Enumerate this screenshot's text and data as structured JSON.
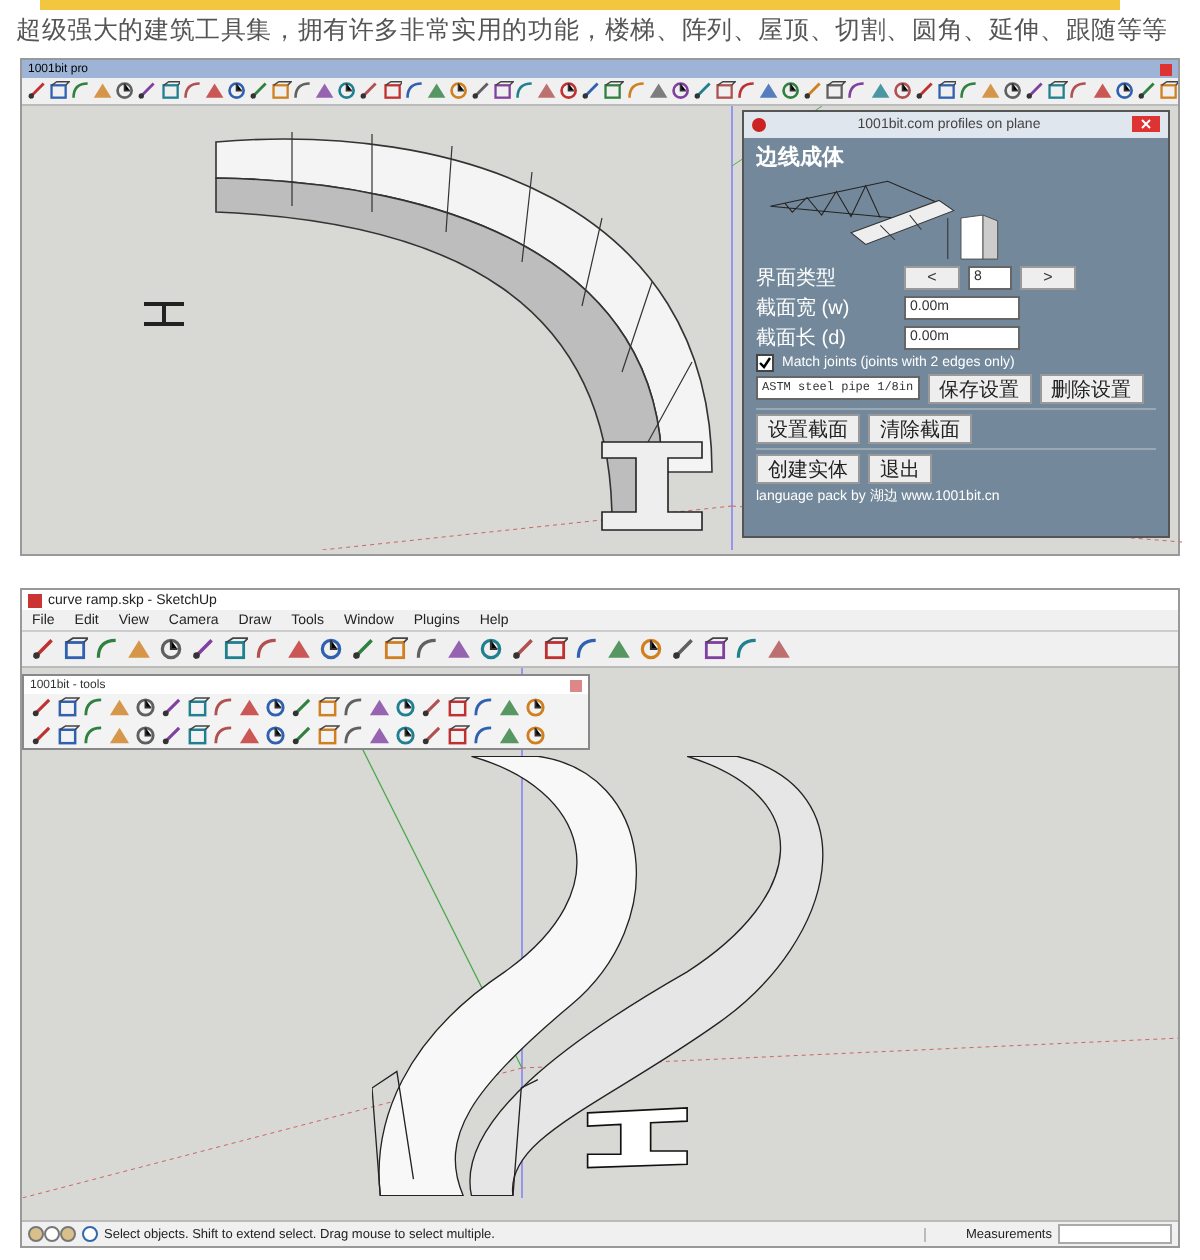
{
  "caption": "超级强大的建筑工具集，拥有许多非常实用的功能，楼梯、阵列、屋顶、切割、圆角、延伸、跟随等等",
  "screenshots": [
    {
      "kind": "plugin-dialog",
      "window_title": "1001bit pro",
      "dialog": {
        "title": "1001bit.com profiles on plane",
        "heading": "边线成体",
        "profile_type_label": "界面类型",
        "prev_button": "<",
        "type_value": "8",
        "next_button": ">",
        "width_label": "截面宽 (w)",
        "width_value": "0.00m",
        "length_label": "截面长 (d)",
        "length_value": "0.00m",
        "match_joints": {
          "label": "Match joints (joints with 2 edges only)",
          "checked": true
        },
        "preset": "ASTM steel pipe 1/8in",
        "button_rows": [
          [
            "保存设置",
            "删除设置"
          ],
          [
            "设置截面",
            "清除截面"
          ],
          [
            "创建实体",
            "退出"
          ]
        ],
        "footer": "language pack by 湖边 www.1001bit.cn"
      }
    },
    {
      "kind": "sketchup",
      "window_title": "curve ramp.skp - SketchUp",
      "menu": [
        "File",
        "Edit",
        "View",
        "Camera",
        "Draw",
        "Tools",
        "Window",
        "Plugins",
        "Help"
      ],
      "palette_title": "1001bit - tools",
      "status_text": "Select objects. Shift to extend select. Drag mouse to select multiple.",
      "measurements_label": "Measurements"
    }
  ]
}
